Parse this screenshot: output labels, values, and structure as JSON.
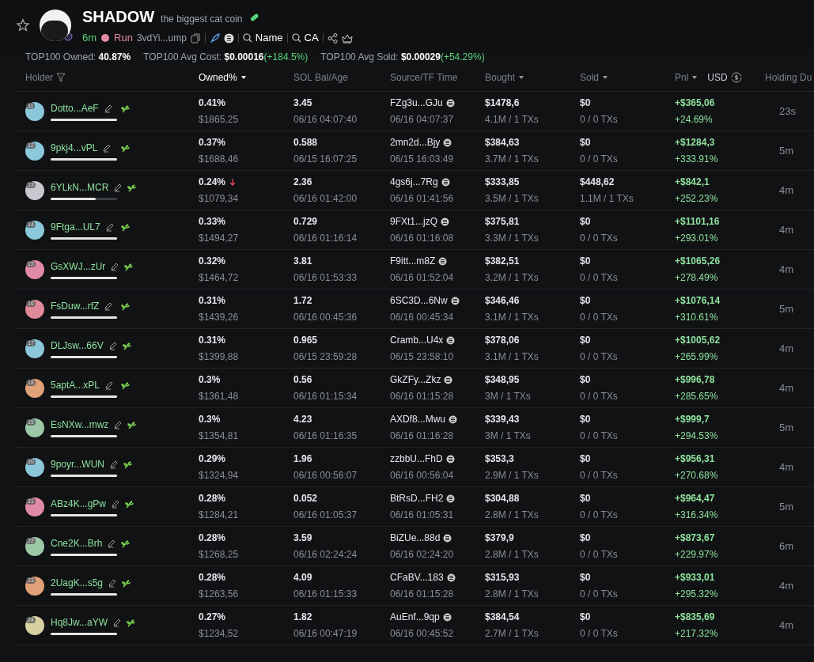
{
  "token": {
    "name": "SHADOW",
    "tagline": "the biggest cat coin",
    "age": "6m",
    "launch": "Run",
    "address": "3vdYi...ump",
    "search_name": "Name",
    "search_ca": "CA"
  },
  "summary": [
    {
      "label": "TOP100 Owned:",
      "value": "40.87%"
    },
    {
      "label": "TOP100 Avg Cost:",
      "value": "$0.00016",
      "change": "(+184.5%)"
    },
    {
      "label": "TOP100 Avg Sold:",
      "value": "$0.00029",
      "change": "(+54.29%)"
    }
  ],
  "columns": [
    {
      "label": "Holder",
      "kind": "filter",
      "selected": false
    },
    {
      "label": "Owned%",
      "kind": "sort",
      "selected": true
    },
    {
      "label": "SOL Bal/Age",
      "kind": "plain",
      "selected": false
    },
    {
      "label": "Source/TF Time",
      "kind": "plain",
      "selected": false
    },
    {
      "label": "Bought",
      "kind": "sort",
      "selected": false
    },
    {
      "label": "Sold",
      "kind": "sort",
      "selected": false
    },
    {
      "label": "Pnl",
      "kind": "currency",
      "currency": "USD",
      "selected": false
    },
    {
      "label": "Holding Du",
      "kind": "plain",
      "selected": false
    }
  ],
  "rows": [
    {
      "rank": "11",
      "color": "#8cc8dc",
      "holder": "Dotto...AeF",
      "level": 1,
      "falling": false,
      "owned": "0.41%",
      "owned_value": "$1865,25",
      "sol": "3.45",
      "sol_age": "06/16 04:07:40",
      "source": "FZg3u...GJu",
      "source_time": "06/16 04:07:37",
      "bought": "$1478,6",
      "bought_detail": "4.1M / 1 TXs",
      "sold": "$0",
      "sold_detail": "0 / 0 TXs",
      "pnl": "+$365,06",
      "pnl_pct": "+24.69%",
      "holding": "23s"
    },
    {
      "rank": "12",
      "color": "#8cc8dc",
      "holder": "9pkj4...vPL",
      "level": 1,
      "falling": false,
      "owned": "0.37%",
      "owned_value": "$1688,46",
      "sol": "0.588",
      "sol_age": "06/15 16:07:25",
      "source": "2mn2d...Bjy",
      "source_time": "06/15 16:03:49",
      "bought": "$384,63",
      "bought_detail": "3.7M / 1 TXs",
      "sold": "$0",
      "sold_detail": "0 / 0 TXs",
      "pnl": "+$1284,3",
      "pnl_pct": "+333.91%",
      "holding": "5m"
    },
    {
      "rank": "13",
      "color": "#c8c8d0",
      "holder": "6YLkN...MCR",
      "level": 0.68,
      "falling": true,
      "owned": "0.24%",
      "owned_value": "$1079,34",
      "sol": "2.36",
      "sol_age": "06/16 01:42:00",
      "source": "4gs6j...7Rg",
      "source_time": "06/16 01:41:56",
      "bought": "$333,85",
      "bought_detail": "3.5M / 1 TXs",
      "sold": "$448,62",
      "sold_detail": "1.1M / 1 TXs",
      "pnl": "+$842,1",
      "pnl_pct": "+252.23%",
      "holding": "4m"
    },
    {
      "rank": "14",
      "color": "#8cc8dc",
      "holder": "9Ftga...UL7",
      "level": 1,
      "falling": false,
      "owned": "0.33%",
      "owned_value": "$1494,27",
      "sol": "0.729",
      "sol_age": "06/16 01:16:14",
      "source": "9FXt1...jzQ",
      "source_time": "06/16 01:16:08",
      "bought": "$375,81",
      "bought_detail": "3.3M / 1 TXs",
      "sold": "$0",
      "sold_detail": "0 / 0 TXs",
      "pnl": "+$1101,16",
      "pnl_pct": "+293.01%",
      "holding": "4m"
    },
    {
      "rank": "15",
      "color": "#e08aa8",
      "holder": "GsXWJ...zUr",
      "level": 1,
      "falling": false,
      "owned": "0.32%",
      "owned_value": "$1464,72",
      "sol": "3.81",
      "sol_age": "06/16 01:53:33",
      "source": "F9itt...m8Z",
      "source_time": "06/16 01:52:04",
      "bought": "$382,51",
      "bought_detail": "3.2M / 1 TXs",
      "sold": "$0",
      "sold_detail": "0 / 0 TXs",
      "pnl": "+$1065,26",
      "pnl_pct": "+278.49%",
      "holding": "4m"
    },
    {
      "rank": "16",
      "color": "#e08a9a",
      "holder": "FsDuw...rfZ",
      "level": 1,
      "falling": false,
      "owned": "0.31%",
      "owned_value": "$1439,26",
      "sol": "1.72",
      "sol_age": "06/16 00:45:36",
      "source": "6SC3D...6Nw",
      "source_time": "06/16 00:45:34",
      "bought": "$346,46",
      "bought_detail": "3.1M / 1 TXs",
      "sold": "$0",
      "sold_detail": "0 / 0 TXs",
      "pnl": "+$1076,14",
      "pnl_pct": "+310.61%",
      "holding": "5m"
    },
    {
      "rank": "17",
      "color": "#8cc8dc",
      "holder": "DLJsw...66V",
      "level": 1,
      "falling": false,
      "owned": "0.31%",
      "owned_value": "$1399,88",
      "sol": "0.965",
      "sol_age": "06/15 23:59:28",
      "source": "Cramb...U4x",
      "source_time": "06/15 23:58:10",
      "bought": "$378,06",
      "bought_detail": "3.1M / 1 TXs",
      "sold": "$0",
      "sold_detail": "0 / 0 TXs",
      "pnl": "+$1005,62",
      "pnl_pct": "+265.99%",
      "holding": "4m"
    },
    {
      "rank": "18",
      "color": "#e0a078",
      "holder": "5aptA...xPL",
      "level": 1,
      "falling": false,
      "owned": "0.3%",
      "owned_value": "$1361,48",
      "sol": "0.56",
      "sol_age": "06/16 01:15:34",
      "source": "GkZFy...Zkz",
      "source_time": "06/16 01:15:28",
      "bought": "$348,95",
      "bought_detail": "3M / 1 TXs",
      "sold": "$0",
      "sold_detail": "0 / 0 TXs",
      "pnl": "+$996,78",
      "pnl_pct": "+285.65%",
      "holding": "4m"
    },
    {
      "rank": "19",
      "color": "#9cc8a8",
      "holder": "EsNXw...mwz",
      "level": 1,
      "falling": false,
      "owned": "0.3%",
      "owned_value": "$1354,81",
      "sol": "4.23",
      "sol_age": "06/16 01:16:35",
      "source": "AXDf8...Mwu",
      "source_time": "06/16 01:16:28",
      "bought": "$339,43",
      "bought_detail": "3M / 1 TXs",
      "sold": "$0",
      "sold_detail": "0 / 0 TXs",
      "pnl": "+$999,7",
      "pnl_pct": "+294.53%",
      "holding": "5m"
    },
    {
      "rank": "20",
      "color": "#8cc8dc",
      "holder": "9poyr...WUN",
      "level": 1,
      "falling": false,
      "owned": "0.29%",
      "owned_value": "$1324,94",
      "sol": "1.96",
      "sol_age": "06/16 00:56:07",
      "source": "zzbbU...FhD",
      "source_time": "06/16 00:56:04",
      "bought": "$353,3",
      "bought_detail": "2.9M / 1 TXs",
      "sold": "$0",
      "sold_detail": "0 / 0 TXs",
      "pnl": "+$956,31",
      "pnl_pct": "+270.68%",
      "holding": "4m"
    },
    {
      "rank": "21",
      "color": "#e08aa8",
      "holder": "ABz4K...gPw",
      "level": 1,
      "falling": false,
      "owned": "0.28%",
      "owned_value": "$1284,21",
      "sol": "0.052",
      "sol_age": "06/16 01:05:37",
      "source": "BtRsD...FH2",
      "source_time": "06/16 01:05:31",
      "bought": "$304,88",
      "bought_detail": "2.8M / 1 TXs",
      "sold": "$0",
      "sold_detail": "0 / 0 TXs",
      "pnl": "+$964,47",
      "pnl_pct": "+316.34%",
      "holding": "5m"
    },
    {
      "rank": "22",
      "color": "#9cc8a8",
      "holder": "Cne2K...Brh",
      "level": 1,
      "falling": false,
      "owned": "0.28%",
      "owned_value": "$1268,25",
      "sol": "3.59",
      "sol_age": "06/16 02:24:24",
      "source": "BiZUe...88d",
      "source_time": "06/16 02:24:20",
      "bought": "$379,9",
      "bought_detail": "2.8M / 1 TXs",
      "sold": "$0",
      "sold_detail": "0 / 0 TXs",
      "pnl": "+$873,67",
      "pnl_pct": "+229.97%",
      "holding": "6m"
    },
    {
      "rank": "23",
      "color": "#e0a078",
      "holder": "2UagK...s5g",
      "level": 1,
      "falling": false,
      "owned": "0.28%",
      "owned_value": "$1263,56",
      "sol": "4.09",
      "sol_age": "06/16 01:15:33",
      "source": "CFaBV...183",
      "source_time": "06/16 01:15:28",
      "bought": "$315,93",
      "bought_detail": "2.8M / 1 TXs",
      "sold": "$0",
      "sold_detail": "0 / 0 TXs",
      "pnl": "+$933,01",
      "pnl_pct": "+295.32%",
      "holding": "4m"
    },
    {
      "rank": "24",
      "color": "#d8d0a0",
      "holder": "Hq8Jw...aYW",
      "level": 1,
      "falling": false,
      "owned": "0.27%",
      "owned_value": "$1234,52",
      "sol": "1.82",
      "sol_age": "06/16 00:47:19",
      "source": "AuEnf...9qp",
      "source_time": "06/16 00:45:52",
      "bought": "$384,54",
      "bought_detail": "2.7M / 1 TXs",
      "sold": "$0",
      "sold_detail": "0 / 0 TXs",
      "pnl": "+$835,69",
      "pnl_pct": "+217.32%",
      "holding": "4m"
    }
  ]
}
